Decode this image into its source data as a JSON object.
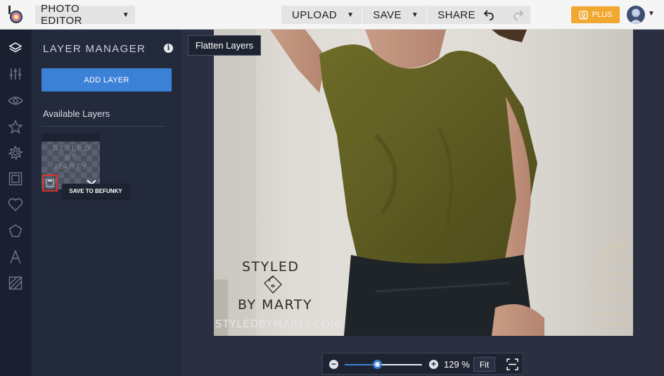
{
  "topbar": {
    "app_title": "PHOTO EDITOR",
    "menus": [
      {
        "label": "UPLOAD"
      },
      {
        "label": "SAVE"
      },
      {
        "label": "SHARE"
      }
    ],
    "plus_label": "PLUS",
    "plus_color": "#f0a830"
  },
  "rail": {
    "icons": [
      "layers-icon",
      "adjustments-icon",
      "eye-icon",
      "star-icon",
      "artsy-icon",
      "frame-icon",
      "heart-icon",
      "texture-icon",
      "text-icon",
      "graphics-icon"
    ]
  },
  "layer_manager": {
    "title": "LAYER MANAGER",
    "add_layer_label": "ADD LAYER",
    "available_layers_label": "Available Layers",
    "save_tooltip": "SAVE TO BEFUNKY",
    "accent_color": "#3b82d6",
    "highlight_color": "#e0312b"
  },
  "canvas": {
    "flatten_tooltip": "Flatten Layers",
    "watermark": {
      "line1": "STYLED",
      "line2": "BY MARTY",
      "url": "STYLEDBYMARTY.COM"
    }
  },
  "zoom": {
    "value_label": "129 %",
    "fit_label": "Fit",
    "level_fraction": 0.42
  }
}
